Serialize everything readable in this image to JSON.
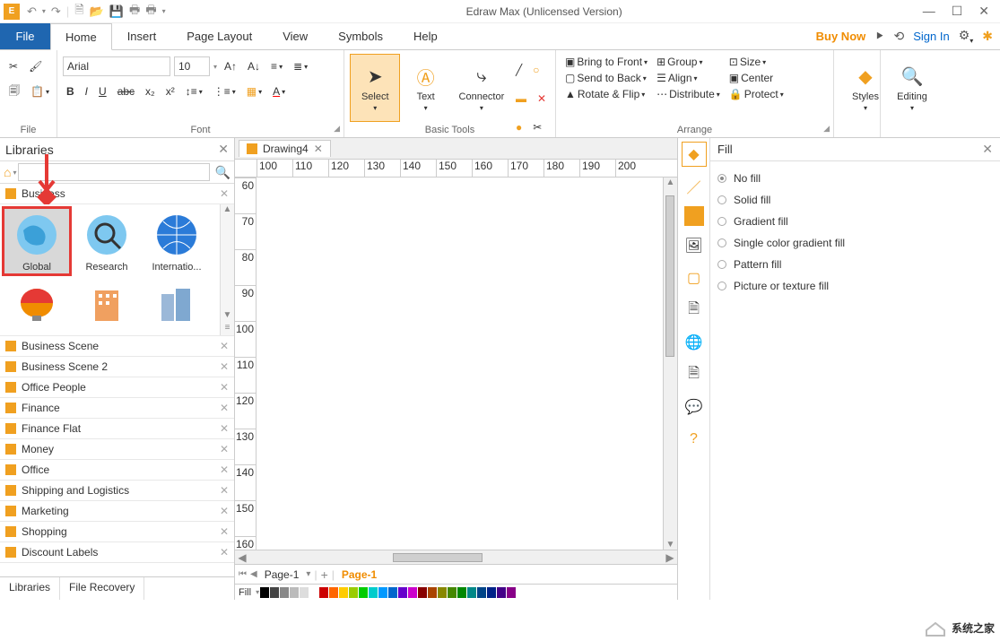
{
  "app": {
    "title": "Edraw Max (Unlicensed Version)"
  },
  "menu": {
    "file": "File",
    "tabs": [
      "Home",
      "Insert",
      "Page Layout",
      "View",
      "Symbols",
      "Help"
    ],
    "active": "Home",
    "buynow": "Buy Now",
    "signin": "Sign In"
  },
  "ribbon": {
    "file_group": "File",
    "font": {
      "name": "Arial",
      "size": "10",
      "label": "Font"
    },
    "tools": {
      "select": "Select",
      "text": "Text",
      "connector": "Connector",
      "label": "Basic Tools"
    },
    "arrange": {
      "bring_front": "Bring to Front",
      "send_back": "Send to Back",
      "rotate_flip": "Rotate & Flip",
      "group": "Group",
      "align": "Align",
      "distribute": "Distribute",
      "size": "Size",
      "center": "Center",
      "protect": "Protect",
      "label": "Arrange"
    },
    "styles": "Styles",
    "editing": "Editing"
  },
  "libraries": {
    "title": "Libraries",
    "categories": [
      "Business",
      "Business Scene",
      "Business Scene 2",
      "Office People",
      "Finance",
      "Finance Flat",
      "Money",
      "Office",
      "Shipping and Logistics",
      "Marketing",
      "Shopping",
      "Discount Labels"
    ],
    "shapes": [
      {
        "name": "Global",
        "sel": true,
        "hl": true
      },
      {
        "name": "Research"
      },
      {
        "name": "Internatio..."
      }
    ],
    "tabs": [
      "Libraries",
      "File Recovery"
    ]
  },
  "doc": {
    "tab": "Drawing4",
    "pages": [
      "Page-1",
      "Page-1"
    ],
    "fill_label": "Fill"
  },
  "ruler_h": [
    "100",
    "110",
    "120",
    "130",
    "140",
    "150",
    "160",
    "170",
    "180",
    "190",
    "200"
  ],
  "ruler_v": [
    "60",
    "70",
    "80",
    "90",
    "100",
    "110",
    "120",
    "130",
    "140",
    "150",
    "160"
  ],
  "fillpanel": {
    "title": "Fill",
    "options": [
      "No fill",
      "Solid fill",
      "Gradient fill",
      "Single color gradient fill",
      "Pattern fill",
      "Picture or texture fill"
    ],
    "selected": 0
  },
  "watermark": "系统之家"
}
